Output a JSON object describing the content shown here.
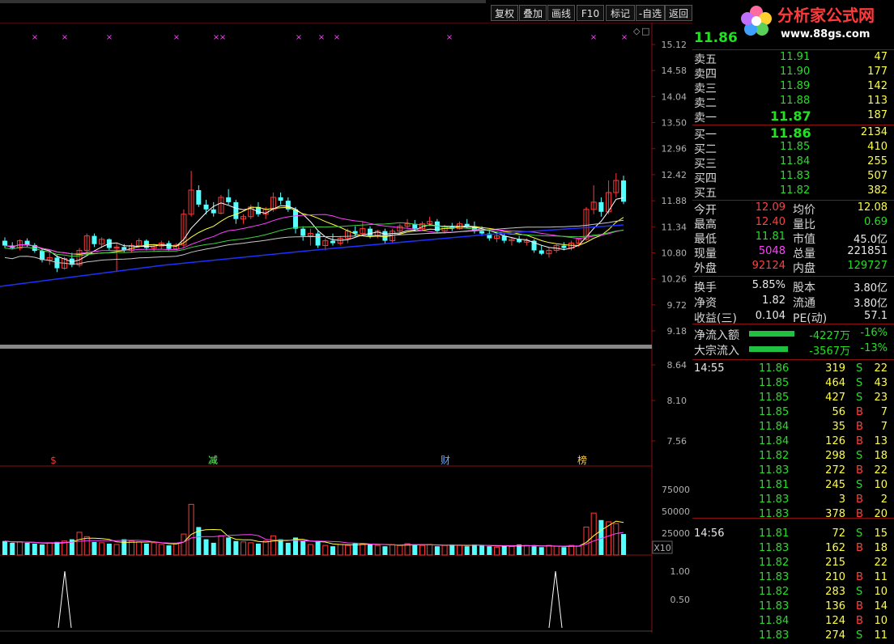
{
  "toolbar": {
    "buttons": [
      {
        "name": "fuquan-button",
        "label": "复权"
      },
      {
        "name": "diejia-button",
        "label": "叠加"
      },
      {
        "name": "huaxian-button",
        "label": "画线"
      },
      {
        "name": "f10-button",
        "label": "F10"
      },
      {
        "name": "biaoji-button",
        "label": "标记"
      },
      {
        "name": "zixuan-button",
        "label": "-自选"
      },
      {
        "name": "fanhui-button",
        "label": "返回"
      }
    ]
  },
  "logo": {
    "title": "分析家公式网",
    "url": "www.88gs.com"
  },
  "quote": {
    "last_price": "11.86",
    "asks": [
      {
        "label": "卖五",
        "price": "11.91",
        "vol": "47"
      },
      {
        "label": "卖四",
        "price": "11.90",
        "vol": "177"
      },
      {
        "label": "卖三",
        "price": "11.89",
        "vol": "142"
      },
      {
        "label": "卖二",
        "price": "11.88",
        "vol": "113"
      },
      {
        "label": "卖一",
        "price": "11.87",
        "vol": "187"
      }
    ],
    "bids": [
      {
        "label": "买一",
        "price": "11.86",
        "vol": "2134"
      },
      {
        "label": "买二",
        "price": "11.85",
        "vol": "410"
      },
      {
        "label": "买三",
        "price": "11.84",
        "vol": "255"
      },
      {
        "label": "买四",
        "price": "11.83",
        "vol": "507"
      },
      {
        "label": "买五",
        "price": "11.82",
        "vol": "382"
      }
    ],
    "stats": [
      {
        "l1": "今开",
        "v1": "12.09",
        "c1": "r",
        "l2": "均价",
        "v2": "12.08",
        "c2": "y"
      },
      {
        "l1": "最高",
        "v1": "12.40",
        "c1": "r",
        "l2": "量比",
        "v2": "0.69",
        "c2": "g"
      },
      {
        "l1": "最低",
        "v1": "11.81",
        "c1": "g",
        "l2": "市值",
        "v2": "45.0亿",
        "c2": "w"
      },
      {
        "l1": "现量",
        "v1": "5048",
        "c1": "m",
        "l2": "总量",
        "v2": "221851",
        "c2": "w"
      },
      {
        "l1": "外盘",
        "v1": "92124",
        "c1": "r",
        "l2": "内盘",
        "v2": "129727",
        "c2": "g"
      }
    ],
    "stats2": [
      {
        "l1": "换手",
        "v1": "5.85%",
        "l2": "股本",
        "v2": "3.80亿"
      },
      {
        "l1": "净资",
        "v1": "1.82",
        "l2": "流通",
        "v2": "3.80亿"
      },
      {
        "l1": "收益(三)",
        "v1": "0.104",
        "l2": "PE(动)",
        "v2": "57.1"
      }
    ],
    "flows": [
      {
        "label": "净流入额",
        "amount": "-4227万",
        "pct": "-16%",
        "bar": 0.8
      },
      {
        "label": "大宗流入",
        "amount": "-3567万",
        "pct": "-13%",
        "bar": 0.68
      }
    ]
  },
  "ticks": [
    {
      "time": "14:55",
      "price": "11.86",
      "vol": "319",
      "side": "S",
      "n": "22"
    },
    {
      "time": "",
      "price": "11.85",
      "vol": "464",
      "side": "S",
      "n": "43"
    },
    {
      "time": "",
      "price": "11.85",
      "vol": "427",
      "side": "S",
      "n": "23"
    },
    {
      "time": "",
      "price": "11.85",
      "vol": "56",
      "side": "B",
      "n": "7"
    },
    {
      "time": "",
      "price": "11.84",
      "vol": "35",
      "side": "B",
      "n": "7"
    },
    {
      "time": "",
      "price": "11.84",
      "vol": "126",
      "side": "B",
      "n": "13"
    },
    {
      "time": "",
      "price": "11.82",
      "vol": "298",
      "side": "S",
      "n": "18"
    },
    {
      "time": "",
      "price": "11.83",
      "vol": "272",
      "side": "B",
      "n": "22"
    },
    {
      "time": "",
      "price": "11.81",
      "vol": "245",
      "side": "S",
      "n": "10"
    },
    {
      "time": "",
      "price": "11.83",
      "vol": "3",
      "side": "B",
      "n": "2"
    },
    {
      "time": "",
      "price": "11.83",
      "vol": "378",
      "side": "B",
      "n": "20"
    },
    {
      "time": "14:56",
      "price": "11.81",
      "vol": "72",
      "side": "S",
      "n": "15"
    },
    {
      "time": "",
      "price": "11.83",
      "vol": "162",
      "side": "B",
      "n": "18"
    },
    {
      "time": "",
      "price": "11.82",
      "vol": "215",
      "side": "",
      "n": "22"
    },
    {
      "time": "",
      "price": "11.83",
      "vol": "210",
      "side": "B",
      "n": "11"
    },
    {
      "time": "",
      "price": "11.82",
      "vol": "283",
      "side": "S",
      "n": "10"
    },
    {
      "time": "",
      "price": "11.83",
      "vol": "136",
      "side": "B",
      "n": "14"
    },
    {
      "time": "",
      "price": "11.84",
      "vol": "124",
      "side": "B",
      "n": "10"
    },
    {
      "time": "",
      "price": "11.83",
      "vol": "274",
      "side": "S",
      "n": "11"
    }
  ],
  "chart_data": {
    "type": "candlestick",
    "price_axis": [
      "15.12",
      "14.58",
      "14.04",
      "13.50",
      "12.96",
      "12.42",
      "11.88",
      "11.34",
      "10.80",
      "10.26",
      "9.72",
      "9.18",
      "8.64",
      "8.10",
      "7.56"
    ],
    "volume_axis": [
      "75000",
      "50000",
      "25000"
    ],
    "volume_unit": "X10",
    "indicator_axis": [
      "1.00",
      "0.50"
    ],
    "ohlc": [
      [
        11.05,
        11.12,
        10.9,
        10.95
      ],
      [
        10.95,
        11.02,
        10.88,
        10.9
      ],
      [
        10.9,
        11.08,
        10.85,
        11.05
      ],
      [
        11.05,
        11.1,
        10.92,
        10.96
      ],
      [
        10.96,
        11.0,
        10.8,
        10.84
      ],
      [
        10.84,
        10.9,
        10.6,
        10.65
      ],
      [
        10.65,
        10.8,
        10.55,
        10.7
      ],
      [
        10.7,
        10.75,
        10.4,
        10.48
      ],
      [
        10.48,
        10.72,
        10.45,
        10.68
      ],
      [
        10.68,
        10.8,
        10.5,
        10.55
      ],
      [
        10.55,
        10.9,
        10.5,
        10.85
      ],
      [
        10.85,
        11.2,
        10.8,
        11.15
      ],
      [
        11.15,
        11.2,
        10.92,
        10.98
      ],
      [
        10.98,
        11.12,
        10.9,
        11.08
      ],
      [
        11.08,
        11.1,
        10.85,
        10.9
      ],
      [
        10.9,
        11.0,
        10.4,
        10.92
      ],
      [
        10.92,
        10.98,
        10.8,
        10.85
      ],
      [
        10.85,
        11.0,
        10.8,
        10.95
      ],
      [
        10.95,
        11.1,
        10.9,
        11.05
      ],
      [
        11.05,
        11.08,
        10.85,
        10.9
      ],
      [
        10.9,
        10.98,
        10.82,
        10.94
      ],
      [
        10.94,
        11.05,
        10.88,
        11.0
      ],
      [
        11.0,
        11.05,
        10.85,
        10.88
      ],
      [
        10.88,
        11.0,
        10.85,
        10.96
      ],
      [
        10.96,
        11.7,
        10.9,
        11.6
      ],
      [
        11.6,
        12.5,
        11.55,
        12.1
      ],
      [
        12.1,
        12.2,
        11.75,
        11.8
      ],
      [
        11.8,
        11.9,
        11.6,
        11.7
      ],
      [
        11.7,
        11.85,
        11.55,
        11.62
      ],
      [
        11.62,
        12.0,
        11.6,
        11.95
      ],
      [
        11.95,
        12.12,
        11.8,
        11.85
      ],
      [
        11.85,
        11.9,
        11.4,
        11.5
      ],
      [
        11.5,
        11.6,
        11.4,
        11.55
      ],
      [
        11.55,
        11.8,
        11.5,
        11.75
      ],
      [
        11.75,
        11.85,
        11.55,
        11.6
      ],
      [
        11.6,
        11.75,
        11.5,
        11.7
      ],
      [
        11.7,
        12.05,
        11.65,
        11.95
      ],
      [
        11.95,
        12.05,
        11.8,
        11.88
      ],
      [
        11.88,
        11.95,
        11.65,
        11.7
      ],
      [
        11.7,
        11.75,
        11.2,
        11.3
      ],
      [
        11.3,
        11.35,
        11.05,
        11.15
      ],
      [
        11.15,
        11.3,
        10.95,
        11.2
      ],
      [
        11.2,
        11.25,
        10.9,
        10.95
      ],
      [
        10.95,
        11.1,
        10.85,
        11.05
      ],
      [
        11.05,
        11.2,
        10.95,
        11.0
      ],
      [
        11.0,
        11.15,
        10.95,
        11.1
      ],
      [
        11.1,
        11.3,
        11.0,
        11.25
      ],
      [
        11.25,
        11.35,
        11.15,
        11.2
      ],
      [
        11.2,
        11.45,
        11.15,
        11.3
      ],
      [
        11.3,
        11.35,
        11.1,
        11.15
      ],
      [
        11.15,
        11.28,
        11.1,
        11.25
      ],
      [
        11.25,
        11.3,
        11.0,
        11.05
      ],
      [
        11.05,
        11.3,
        11.0,
        11.25
      ],
      [
        11.25,
        11.4,
        11.2,
        11.35
      ],
      [
        11.35,
        11.5,
        11.3,
        11.4
      ],
      [
        11.4,
        11.48,
        11.25,
        11.3
      ],
      [
        11.3,
        11.45,
        11.25,
        11.4
      ],
      [
        11.4,
        11.55,
        11.35,
        11.45
      ],
      [
        11.45,
        11.5,
        11.2,
        11.25
      ],
      [
        11.25,
        11.38,
        11.2,
        11.35
      ],
      [
        11.35,
        11.42,
        11.25,
        11.3
      ],
      [
        11.3,
        11.45,
        11.28,
        11.4
      ],
      [
        11.4,
        11.5,
        11.3,
        11.35
      ],
      [
        11.35,
        11.45,
        11.2,
        11.25
      ],
      [
        11.25,
        11.35,
        11.15,
        11.2
      ],
      [
        11.2,
        11.28,
        11.05,
        11.1
      ],
      [
        11.1,
        11.2,
        11.02,
        11.15
      ],
      [
        11.15,
        11.22,
        11.0,
        11.05
      ],
      [
        11.05,
        11.12,
        10.95,
        11.08
      ],
      [
        11.08,
        11.15,
        11.0,
        11.02
      ],
      [
        11.02,
        11.1,
        10.95,
        11.05
      ],
      [
        11.05,
        11.08,
        10.8,
        10.85
      ],
      [
        10.85,
        10.95,
        10.75,
        10.78
      ],
      [
        10.78,
        10.9,
        10.7,
        10.85
      ],
      [
        10.85,
        10.98,
        10.8,
        10.95
      ],
      [
        10.95,
        11.02,
        10.85,
        10.9
      ],
      [
        10.9,
        11.05,
        10.85,
        11.0
      ],
      [
        11.0,
        11.1,
        10.92,
        11.08
      ],
      [
        11.08,
        11.75,
        11.05,
        11.7
      ],
      [
        11.7,
        12.2,
        11.6,
        11.85
      ],
      [
        11.85,
        11.95,
        11.55,
        11.65
      ],
      [
        11.65,
        12.3,
        11.6,
        12.05
      ],
      [
        12.05,
        12.45,
        11.95,
        12.3
      ],
      [
        12.3,
        12.4,
        11.81,
        11.86
      ]
    ],
    "volume": [
      16,
      14,
      15,
      14,
      13,
      12,
      14,
      15,
      16,
      18,
      26,
      21,
      15,
      14,
      13,
      12,
      18,
      16,
      15,
      13,
      14,
      12,
      11,
      13,
      24,
      58,
      32,
      18,
      14,
      22,
      20,
      16,
      15,
      14,
      13,
      16,
      22,
      18,
      14,
      20,
      16,
      12,
      15,
      11,
      10,
      12,
      11,
      14,
      13,
      12,
      11,
      10,
      12,
      11,
      13,
      12,
      11,
      12,
      10,
      11,
      12,
      11,
      10,
      12,
      11,
      10,
      9,
      11,
      10,
      12,
      11,
      10,
      9,
      11,
      10,
      9,
      11,
      10,
      32,
      48,
      40,
      38,
      36,
      24
    ],
    "markers": [
      {
        "label": "$",
        "color": "#ff3030",
        "at": 12
      },
      {
        "label": "减",
        "color": "#66ff66",
        "at": 48
      },
      {
        "label": "财",
        "color": "#66aaff",
        "at": 100
      },
      {
        "label": "榜",
        "color": "#ffcc44",
        "at": 131
      }
    ]
  }
}
